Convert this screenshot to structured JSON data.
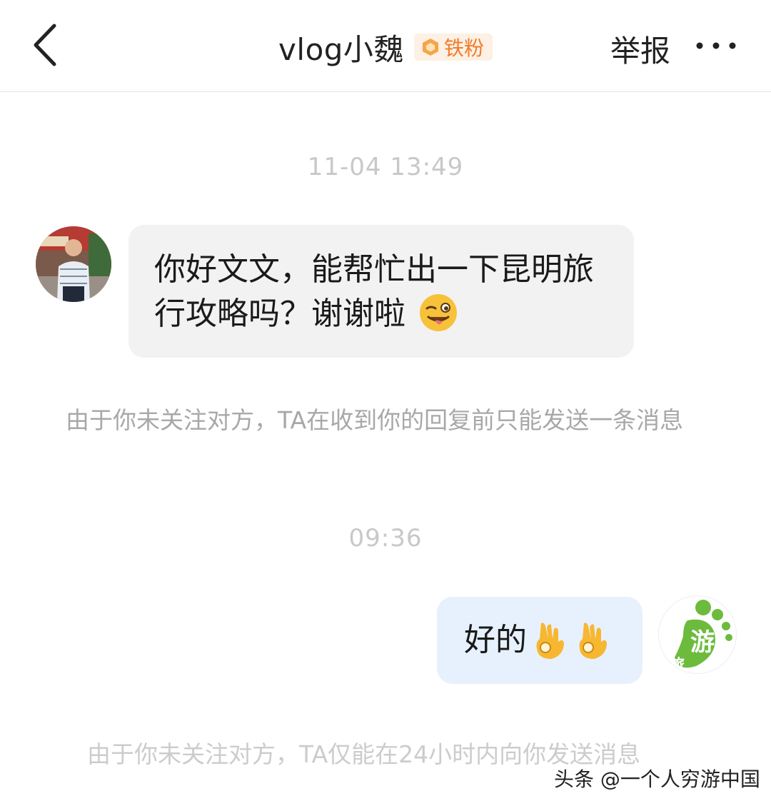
{
  "header": {
    "title": "vlog小魏",
    "badge_label": "铁粉",
    "report_label": "举报",
    "back_icon": "chevron-left-icon",
    "more_icon": "more-dots-icon"
  },
  "messages": {
    "time_1": "11-04 13:49",
    "incoming_text": "你好文文，能帮忙出一下昆明旅行攻略吗？谢谢啦",
    "notice_1": "由于你未关注对方，TA在收到你的回复前只能发送一条消息",
    "time_2": "09:36",
    "outgoing_text": "好的",
    "notice_2": "由于你未关注对方，TA仅能在24小时内向你发送消息"
  },
  "avatar_right": {
    "logo_text_main": "游",
    "logo_text_small": "旅"
  },
  "watermark": "头条 @一个人穷游中国",
  "colors": {
    "incoming_bubble": "#f2f2f2",
    "outgoing_bubble": "#e6f1fd",
    "badge_text": "#f07c2c",
    "badge_bg": "#fdf0e4",
    "logo_green": "#6cbb3c"
  }
}
